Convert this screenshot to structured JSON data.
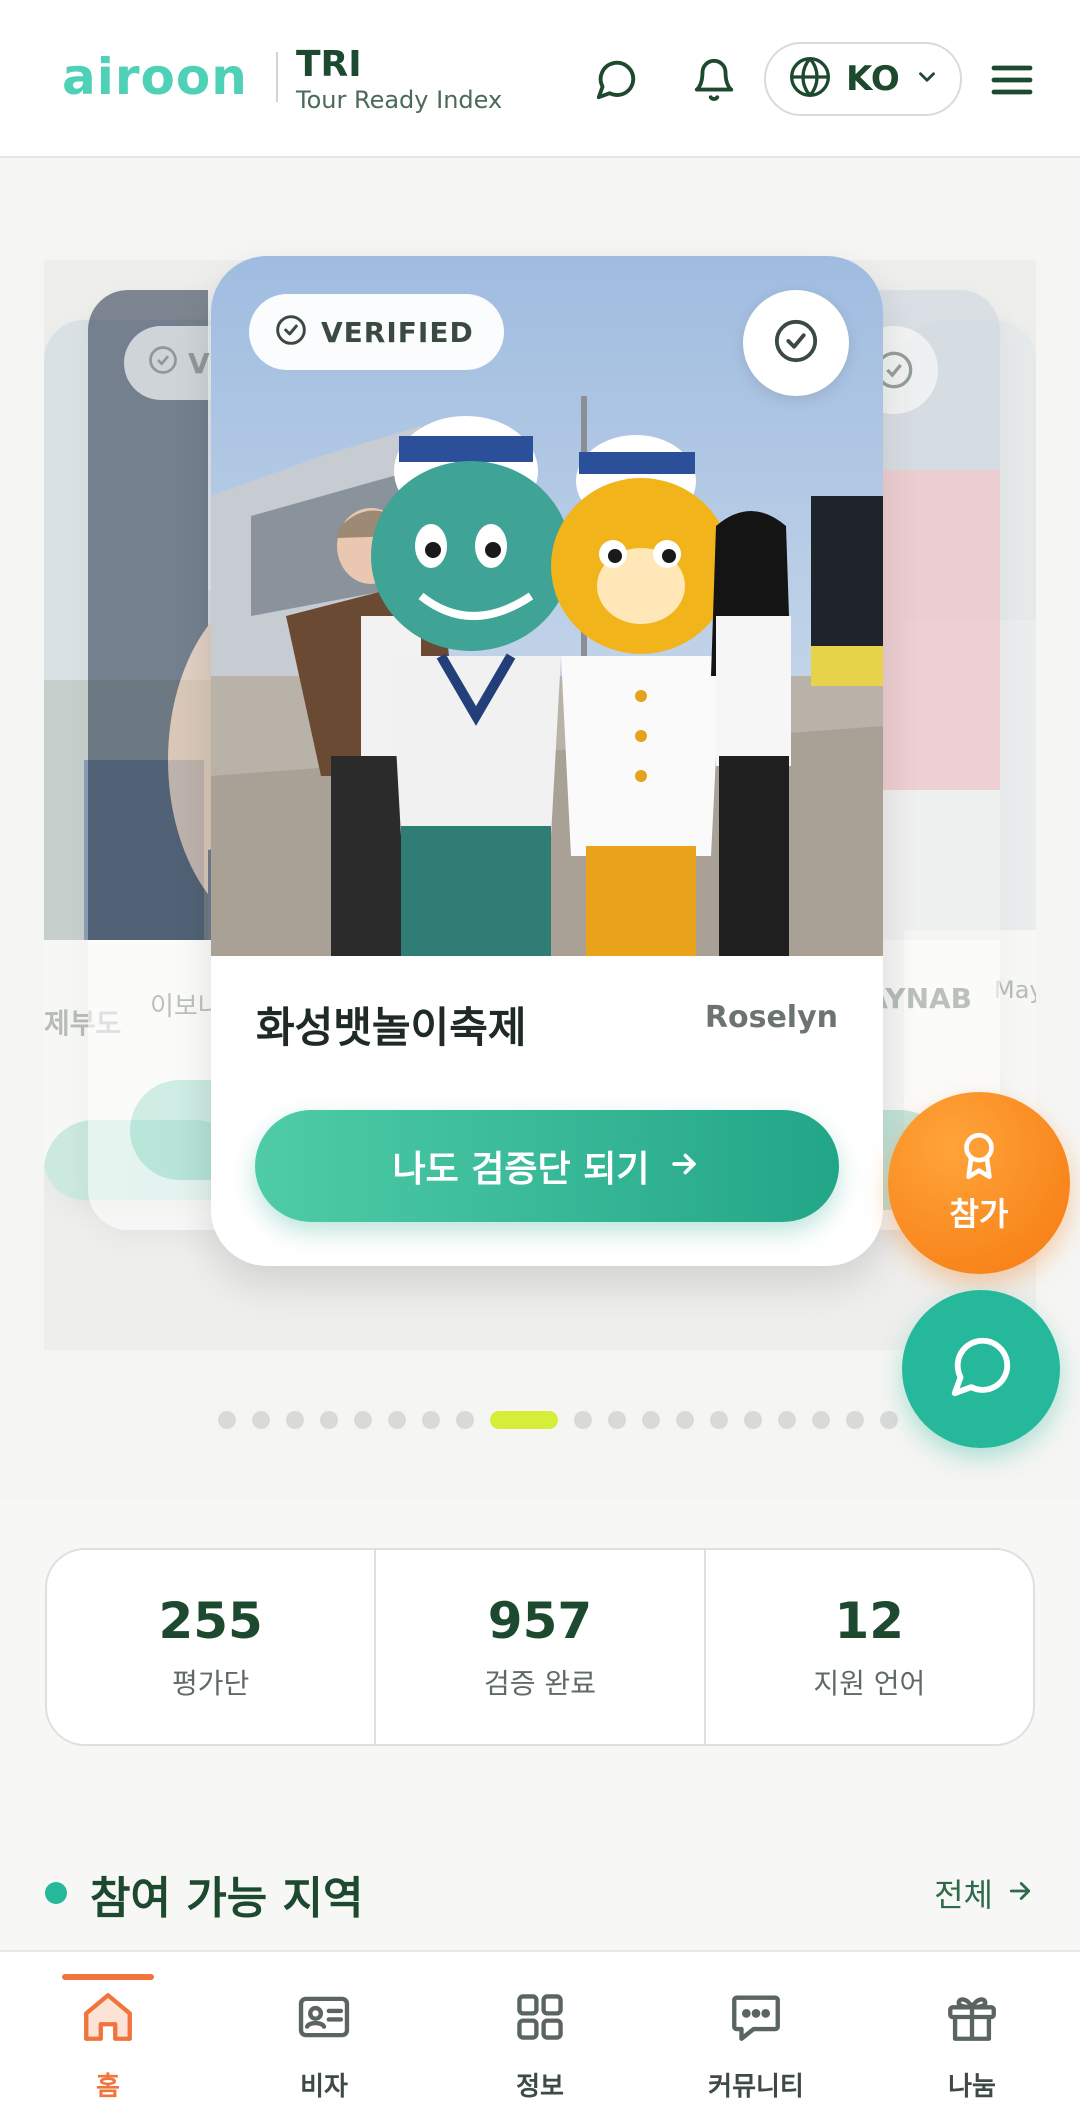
{
  "header": {
    "logo": "airoon",
    "brand_title": "TRI",
    "brand_subtitle": "Tour Ready Index",
    "language": "KO",
    "icons": [
      "chat-icon",
      "bell-icon",
      "globe-icon",
      "chevron-down-icon",
      "menu-icon"
    ]
  },
  "carousel": {
    "main_card": {
      "badge": "VERIFIED",
      "title": "화성뱃놀이축제",
      "author": "Roselyn",
      "cta_label": "나도 검증단 되기"
    },
    "side_cards": {
      "far_left_title": "제부도",
      "left_title": "이보나",
      "left_badge": "VERIFIED",
      "right_author": "ZAYNAB",
      "far_right_author": "Mayank"
    },
    "dot_count": 19,
    "active_dot_index": 8
  },
  "fab": {
    "join_label": "참가",
    "colors": {
      "join": "#f57a10",
      "chat": "#26b89a"
    }
  },
  "stats": [
    {
      "value": "255",
      "label": "평가단"
    },
    {
      "value": "957",
      "label": "검증 완료"
    },
    {
      "value": "12",
      "label": "지원 언어"
    }
  ],
  "section": {
    "title": "참여 가능 지역",
    "link_label": "전체"
  },
  "bottom_nav": [
    {
      "label": "홈",
      "icon": "home-icon",
      "active": true
    },
    {
      "label": "비자",
      "icon": "id-card-icon",
      "active": false
    },
    {
      "label": "정보",
      "icon": "grid-icon",
      "active": false
    },
    {
      "label": "커뮤니티",
      "icon": "message-icon",
      "active": false
    },
    {
      "label": "나눔",
      "icon": "gift-icon",
      "active": false
    }
  ],
  "colors": {
    "accent": "#26b89a",
    "brand_dark": "#1d4a2e",
    "orange": "#f0743c",
    "active_dot": "#d6ee3a"
  }
}
